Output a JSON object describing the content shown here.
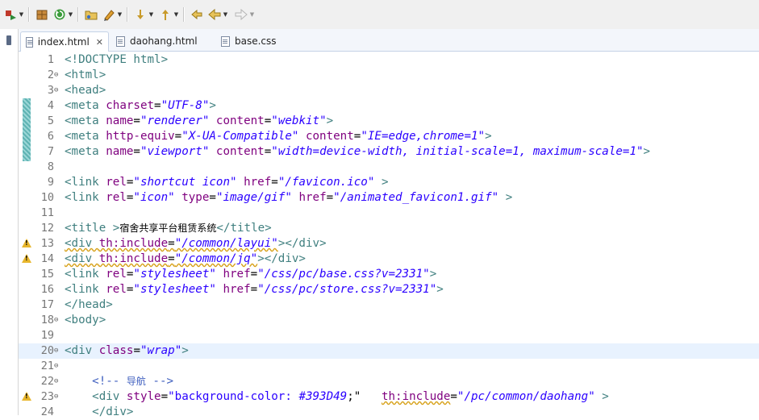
{
  "tabs": [
    {
      "label": "index.html",
      "active": true,
      "close": "✕"
    },
    {
      "label": "daohang.html",
      "active": false
    },
    {
      "label": "base.css",
      "active": false
    }
  ],
  "lines": [
    {
      "n": "1",
      "code": "<!DOCTYPE html>"
    },
    {
      "n": "2",
      "code": "<html>"
    },
    {
      "n": "3",
      "code": "<head>"
    },
    {
      "n": "4",
      "code": "<meta charset=\"UTF-8\">"
    },
    {
      "n": "5",
      "code": "<meta name=\"renderer\" content=\"webkit\">"
    },
    {
      "n": "6",
      "code": "<meta http-equiv=\"X-UA-Compatible\" content=\"IE=edge,chrome=1\">"
    },
    {
      "n": "7",
      "code": "<meta name=\"viewport\" content=\"width=device-width, initial-scale=1, maximum-scale=1\">"
    },
    {
      "n": "8",
      "code": ""
    },
    {
      "n": "9",
      "code": "<link rel=\"shortcut icon\" href=\"/favicon.ico\" >"
    },
    {
      "n": "10",
      "code": "<link rel=\"icon\" type=\"image/gif\" href=\"/animated_favicon1.gif\" >"
    },
    {
      "n": "11",
      "code": ""
    },
    {
      "n": "12",
      "code": "<title >宿舍共享平台租赁系统</title>"
    },
    {
      "n": "13",
      "code": "<div th:include=\"/common/layui\"></div>"
    },
    {
      "n": "14",
      "code": "<div th:include=\"/common/jq\"></div>"
    },
    {
      "n": "15",
      "code": "<link rel=\"stylesheet\" href=\"/css/pc/base.css?v=2331\">"
    },
    {
      "n": "16",
      "code": "<link rel=\"stylesheet\" href=\"/css/pc/store.css?v=2331\">"
    },
    {
      "n": "17",
      "code": "</head>"
    },
    {
      "n": "18",
      "code": "<body>"
    },
    {
      "n": "19",
      "code": ""
    },
    {
      "n": "20",
      "code": "<div class=\"wrap\">"
    },
    {
      "n": "21",
      "code": ""
    },
    {
      "n": "22",
      "code": "    <!-- 导航 -->"
    },
    {
      "n": "23",
      "code": "    <div style=\"background-color: #393D49;\"   th:include=\"/pc/common/daohang\" >"
    },
    {
      "n": "24",
      "code": "    </div>"
    }
  ],
  "colors": {
    "tag": "#3f7f7f",
    "attr": "#7f007f",
    "value": "#2a00ff",
    "comment": "#3f5fbf",
    "highlight": "#e8f2fe",
    "warning": "#e8b62c"
  }
}
